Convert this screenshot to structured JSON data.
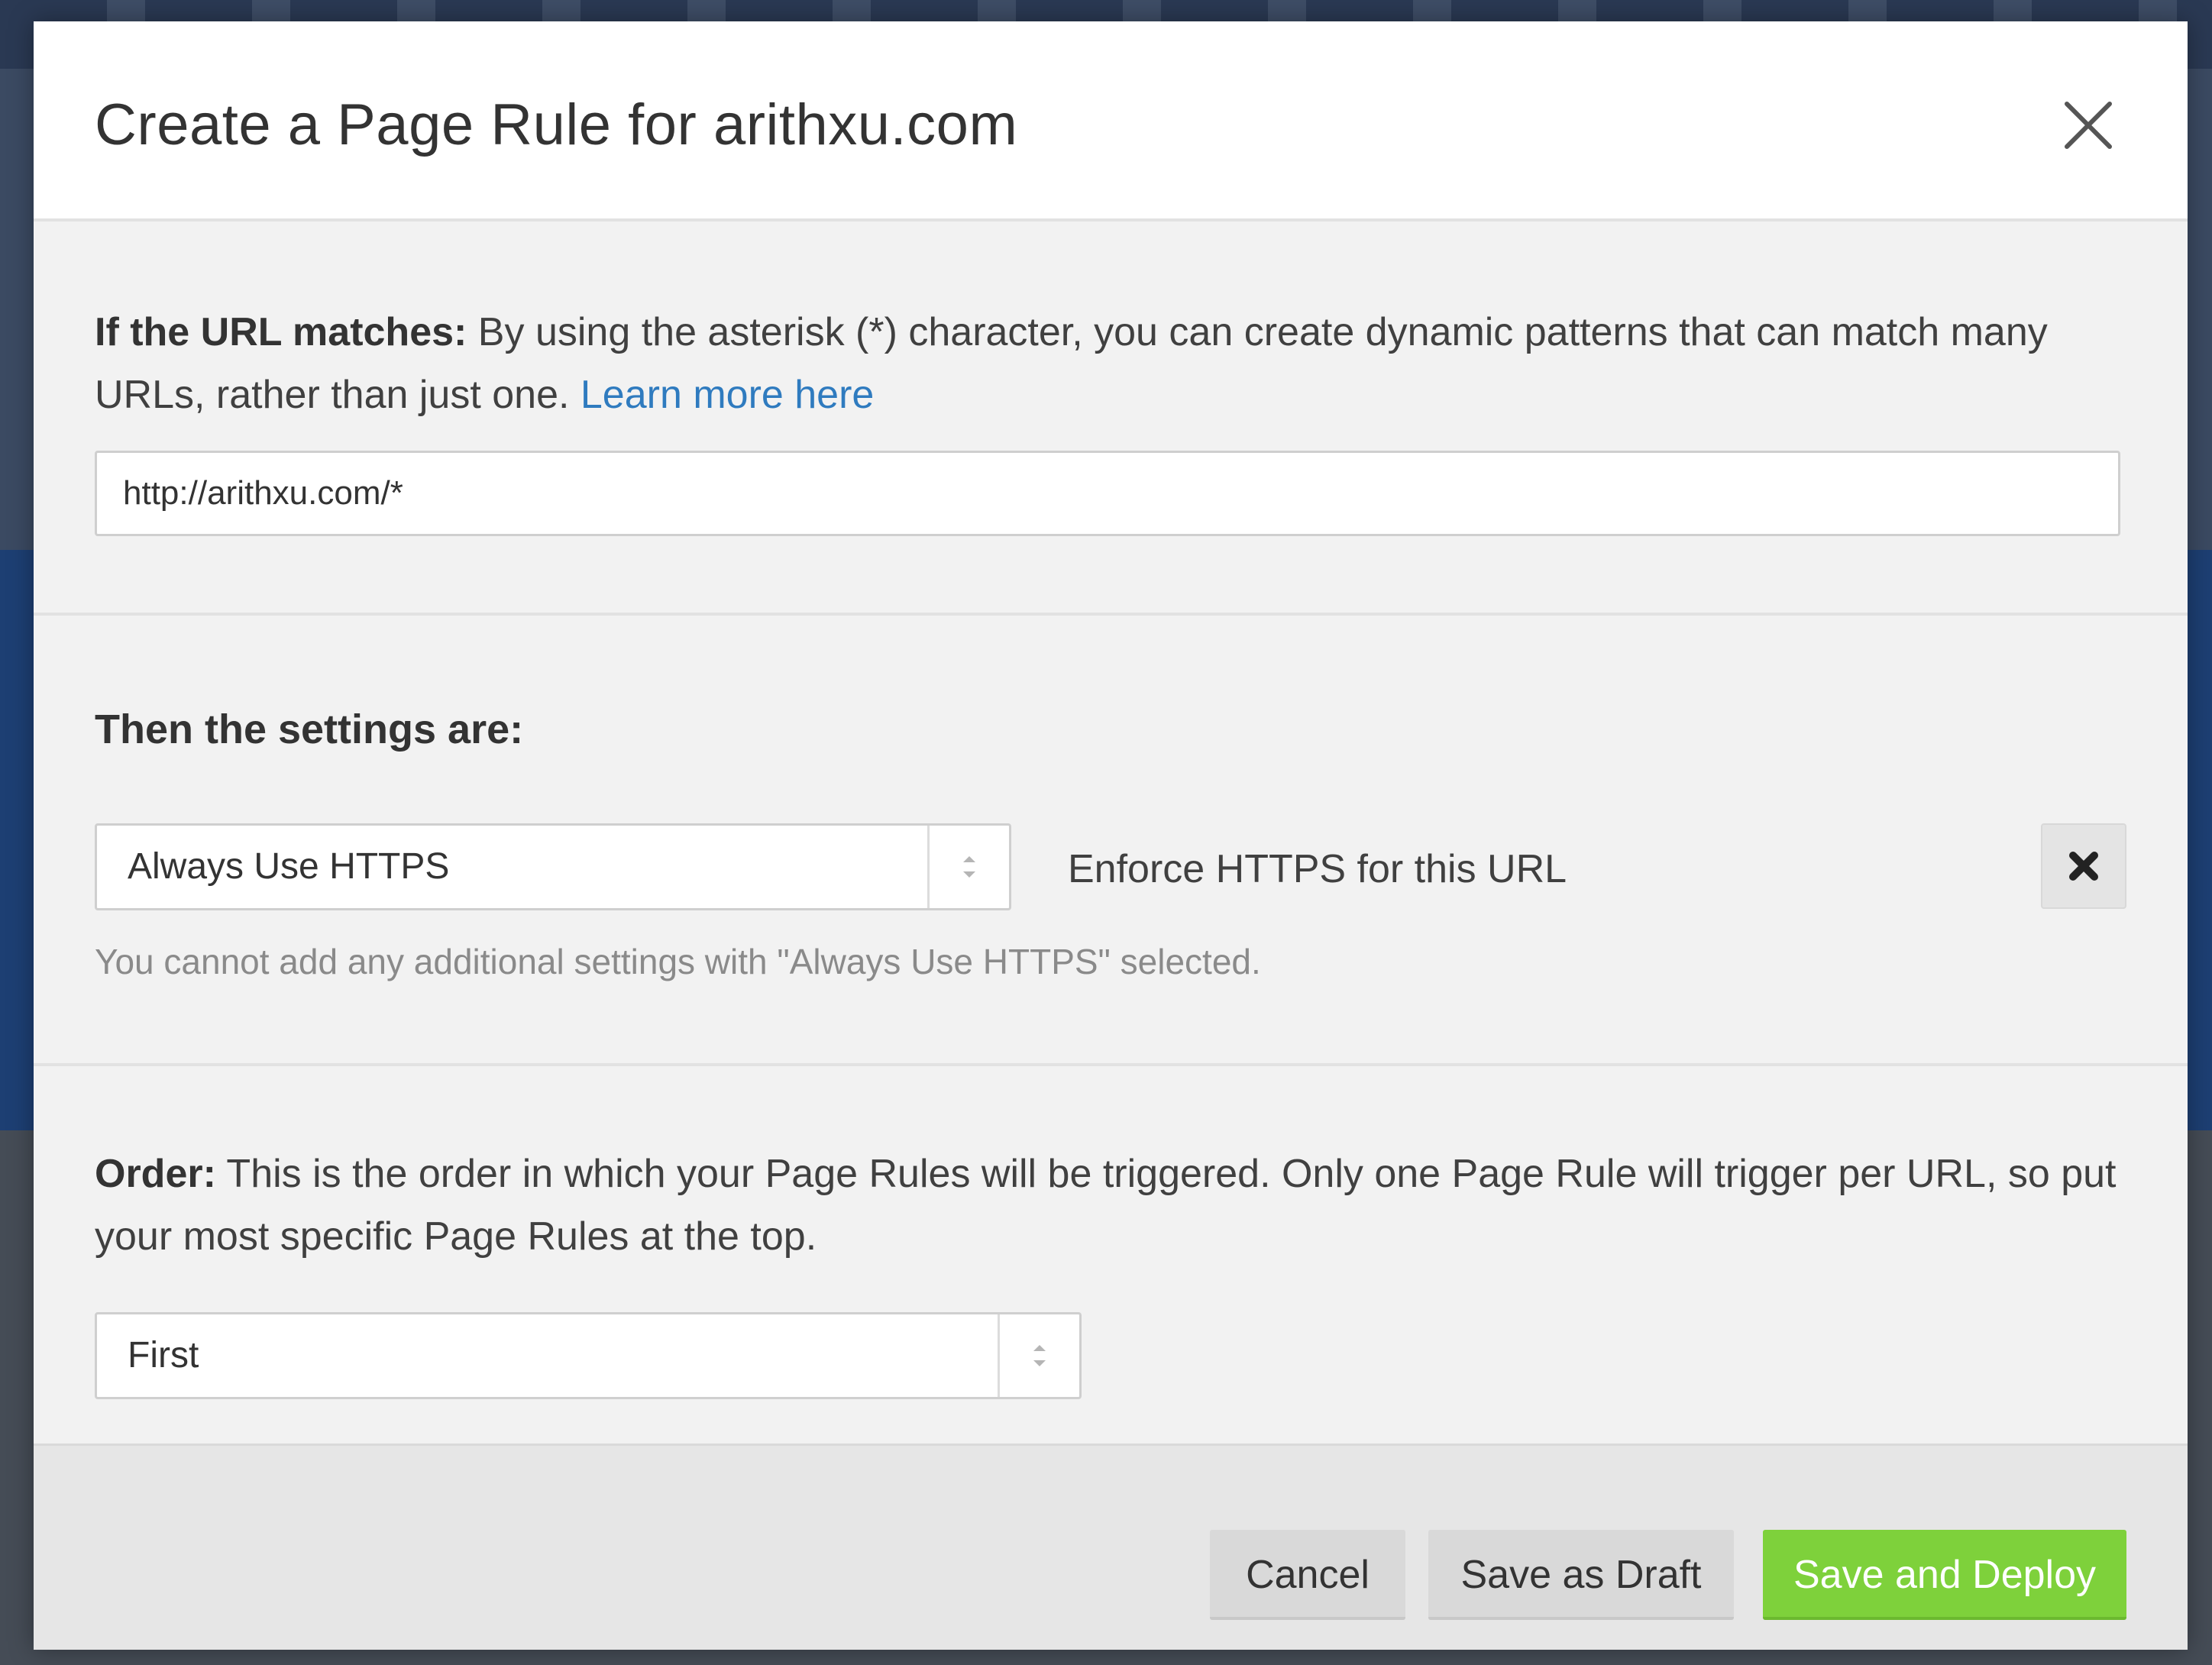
{
  "modal": {
    "title": "Create a Page Rule for arithxu.com",
    "close_icon": "close-icon"
  },
  "url_section": {
    "label": "If the URL matches:",
    "description": " By using the asterisk (*) character, you can create dynamic patterns that can match many URLs, rather than just one. ",
    "link_text": "Learn more here",
    "url_value": "http://arithxu.com/*"
  },
  "settings_section": {
    "heading": "Then the settings are:",
    "setting_selected": "Always Use HTTPS",
    "setting_description": "Enforce HTTPS for this URL",
    "remove_icon": "x-icon",
    "hint": "You cannot add any additional settings with \"Always Use HTTPS\" selected."
  },
  "order_section": {
    "label": "Order:",
    "description": " This is the order in which your Page Rules will be triggered. Only one Page Rule will trigger per URL, so put your most specific Page Rules at the top.",
    "selected": "First"
  },
  "footer": {
    "cancel_label": "Cancel",
    "draft_label": "Save as Draft",
    "deploy_label": "Save and Deploy"
  },
  "colors": {
    "primary_button": "#7ed13b",
    "link": "#2f7bbf",
    "hint_text": "#8a8a8a"
  }
}
